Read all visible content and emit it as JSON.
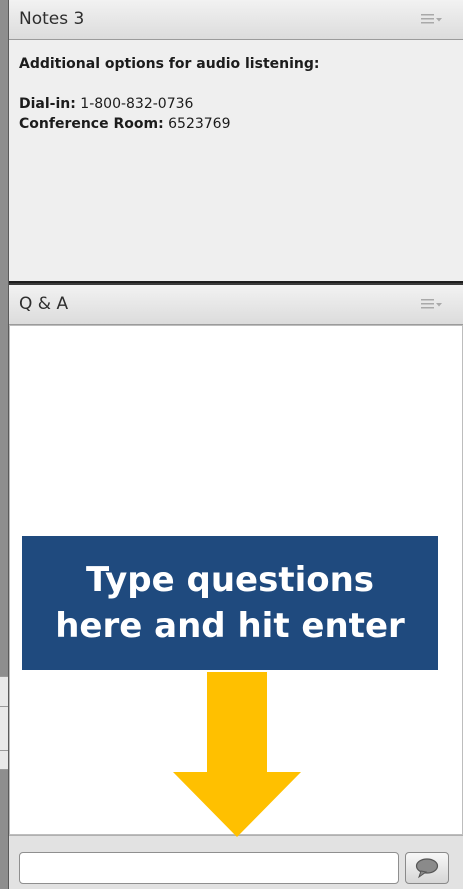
{
  "notes_pod": {
    "title": "Notes 3",
    "heading": "Additional options for audio listening:",
    "dialin_label": "Dial-in:",
    "dialin_value": "1-800-832-0736",
    "conference_label": "Conference Room:",
    "conference_value": "6523769"
  },
  "qa_pod": {
    "title": "Q & A",
    "input_value": "",
    "input_placeholder": ""
  },
  "annotation": {
    "line1": "Type questions",
    "line2": "here and hit enter"
  },
  "icons": {
    "pod_menu": "pod-menu-icon",
    "send": "speech-bubble-icon",
    "arrow": "down-arrow-icon"
  },
  "colors": {
    "callout_bg": "#1f4a7e",
    "arrow": "#ffc000",
    "callout_text": "#ffffff"
  }
}
